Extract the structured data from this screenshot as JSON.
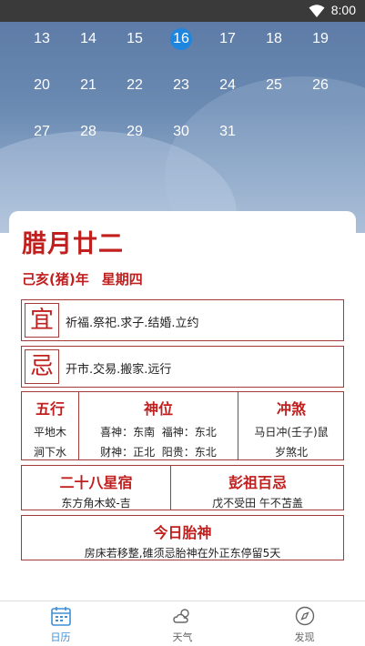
{
  "status_bar": {
    "time": "8:00"
  },
  "calendar": {
    "rows": [
      [
        "13",
        "14",
        "15",
        "16",
        "17",
        "18",
        "19"
      ],
      [
        "20",
        "21",
        "22",
        "23",
        "24",
        "25",
        "26"
      ],
      [
        "27",
        "28",
        "29",
        "30",
        "31"
      ]
    ],
    "today": "16",
    "today_color": "#1f86e0"
  },
  "details": {
    "lunar_date": "腊月廿二",
    "year_ganzhi": "己亥(猪)年",
    "weekday": "星期四",
    "yi": {
      "glyph": "宜",
      "text": "祈福.祭祀.求子.结婚.立约"
    },
    "ji": {
      "glyph": "忌",
      "text": "开市.交易.搬家.远行"
    },
    "wuxing": {
      "title": "五行",
      "line1": "平地木",
      "line2": "涧下水"
    },
    "shenwei": {
      "title": "神位",
      "line1": "喜神：东南  福神：东北",
      "line2": "财神：正北  阳贵：东北"
    },
    "chongsha": {
      "title": "冲煞",
      "line1": "马日冲(壬子)鼠",
      "line2": "岁煞北"
    },
    "xingxiu": {
      "title": "二十八星宿",
      "text": "东方角木蛟-吉"
    },
    "pengzu": {
      "title": "彭祖百忌",
      "text": "戊不受田 午不苫盖"
    },
    "taishen": {
      "title": "今日胎神",
      "text": "房床若移整,碓须忌胎神在外正东停留5天"
    }
  },
  "tabs": [
    {
      "label": "日历",
      "icon": "calendar-icon",
      "active": true
    },
    {
      "label": "天气",
      "icon": "weather-icon",
      "active": false
    },
    {
      "label": "发现",
      "icon": "compass-icon",
      "active": false
    }
  ],
  "colors": {
    "accent_red": "#c11e1e",
    "tab_active": "#3d8fd6",
    "tab_inactive": "#666666"
  }
}
